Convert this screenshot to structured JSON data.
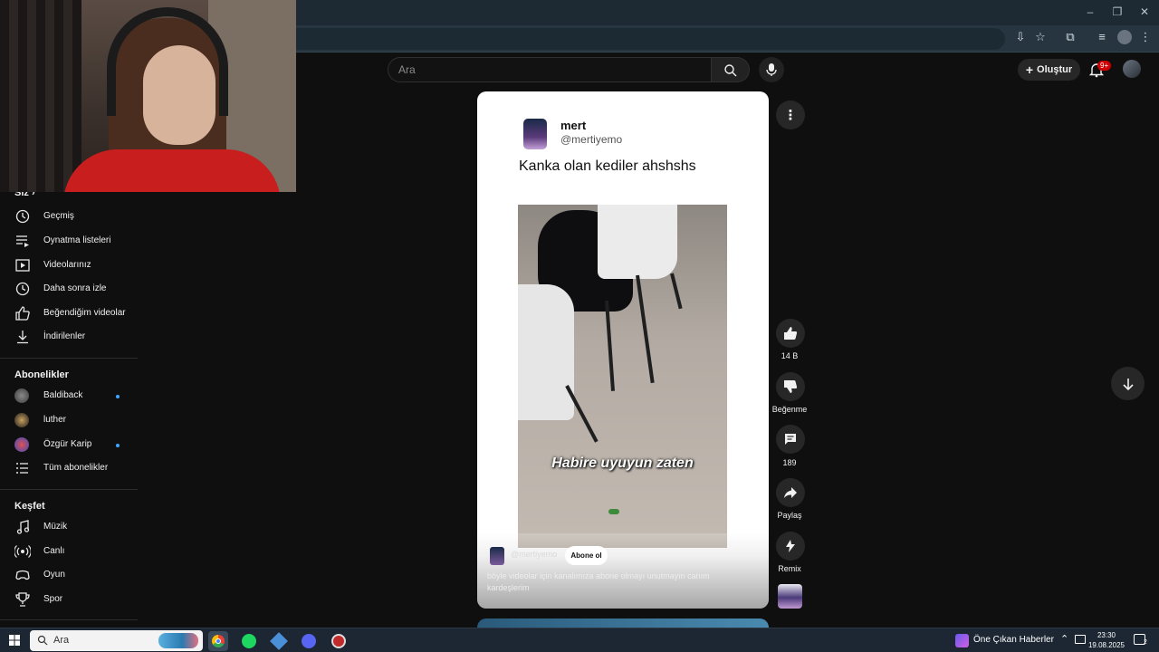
{
  "header": {
    "search_placeholder": "Ara",
    "create_label": "Oluştur",
    "notifications_badge": "9+"
  },
  "sidebar": {
    "you_section": "Siz",
    "you_items": [
      {
        "label": "Geçmiş",
        "icon": "history-icon"
      },
      {
        "label": "Oynatma listeleri",
        "icon": "playlist-icon"
      },
      {
        "label": "Videolarınız",
        "icon": "your-videos-icon"
      },
      {
        "label": "Daha sonra izle",
        "icon": "watch-later-icon"
      },
      {
        "label": "Beğendiğim videolar",
        "icon": "liked-videos-icon"
      },
      {
        "label": "İndirilenler",
        "icon": "download-icon"
      }
    ],
    "subs_section": "Abonelikler",
    "subs_items": [
      {
        "label": "Baldiback",
        "new": true
      },
      {
        "label": "luther",
        "new": false
      },
      {
        "label": "Özgür Karip",
        "new": true
      },
      {
        "label": "Tüm abonelikler",
        "new": false
      }
    ],
    "explore_section": "Keşfet",
    "explore_items": [
      {
        "label": "Müzik",
        "icon": "music-icon"
      },
      {
        "label": "Canlı",
        "icon": "live-icon"
      },
      {
        "label": "Oyun",
        "icon": "gaming-icon"
      },
      {
        "label": "Spor",
        "icon": "trophy-icon"
      }
    ]
  },
  "short": {
    "tweet_name": "mert",
    "tweet_handle": "@mertiyemo",
    "tweet_text": "Kanka olan kediler ahshshs",
    "video_caption": "Habire uyuyun zaten",
    "channel_handle": "@mertiyemo",
    "subscribe_label": "Abone ol",
    "description": "böyle videolar için kanalımıza abone olmayı unutmayın canım kardeşlerim"
  },
  "actions": {
    "like_count": "14 B",
    "dislike_label": "Beğenme",
    "comment_count": "189",
    "share_label": "Paylaş",
    "remix_label": "Remix"
  },
  "taskbar": {
    "search_placeholder": "Ara",
    "news_label": "Öne Çıkan Haberler",
    "time": "23:30",
    "date": "19.08.2025",
    "notification_count": "2"
  }
}
